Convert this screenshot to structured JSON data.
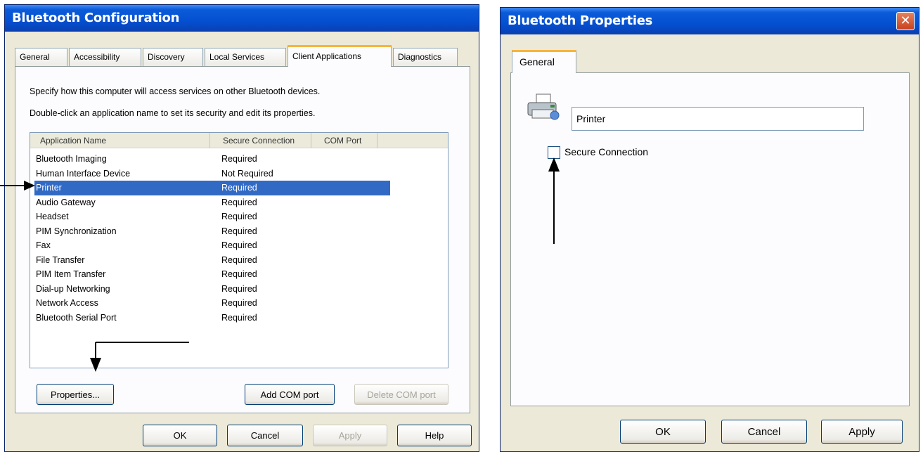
{
  "left_dialog": {
    "title": "Bluetooth Configuration",
    "tabs": [
      "General",
      "Accessibility",
      "Discovery",
      "Local Services",
      "Client Applications",
      "Diagnostics"
    ],
    "active_tab": "Client Applications",
    "description_1": "Specify how this computer will access services on other Bluetooth devices.",
    "description_2": "Double-click an application name to set its security and edit its properties.",
    "columns": [
      "Application Name",
      "Secure Connection",
      "COM Port"
    ],
    "rows": [
      {
        "name": "Bluetooth Imaging",
        "secure": "Required"
      },
      {
        "name": "Human Interface Device",
        "secure": "Not Required"
      },
      {
        "name": "Printer",
        "secure": "Required"
      },
      {
        "name": "Audio Gateway",
        "secure": "Required"
      },
      {
        "name": "Headset",
        "secure": "Required"
      },
      {
        "name": "PIM Synchronization",
        "secure": "Required"
      },
      {
        "name": "Fax",
        "secure": "Required"
      },
      {
        "name": "File Transfer",
        "secure": "Required"
      },
      {
        "name": "PIM Item Transfer",
        "secure": "Required"
      },
      {
        "name": "Dial-up Networking",
        "secure": "Required"
      },
      {
        "name": "Network Access",
        "secure": "Required"
      },
      {
        "name": "Bluetooth Serial Port",
        "secure": "Required"
      }
    ],
    "selected_row": "Printer",
    "buttons": {
      "properties": "Properties...",
      "add_com_port": "Add COM port",
      "delete_com_port": "Delete COM port",
      "ok": "OK",
      "cancel": "Cancel",
      "apply": "Apply",
      "help": "Help"
    }
  },
  "right_dialog": {
    "title": "Bluetooth Properties",
    "close_icon": "close-icon",
    "tab": "General",
    "icon": "printer-icon",
    "name_value": "Printer",
    "secure_connection_label": "Secure Connection",
    "secure_connection_checked": false,
    "buttons": {
      "ok": "OK",
      "cancel": "Cancel",
      "apply": "Apply"
    }
  },
  "colors": {
    "titlebar": "#0450d2",
    "selection": "#316ac5",
    "tab_highlight": "#f8b33c",
    "dialog_bg": "#ece9d8",
    "close_button": "#c8421c"
  }
}
